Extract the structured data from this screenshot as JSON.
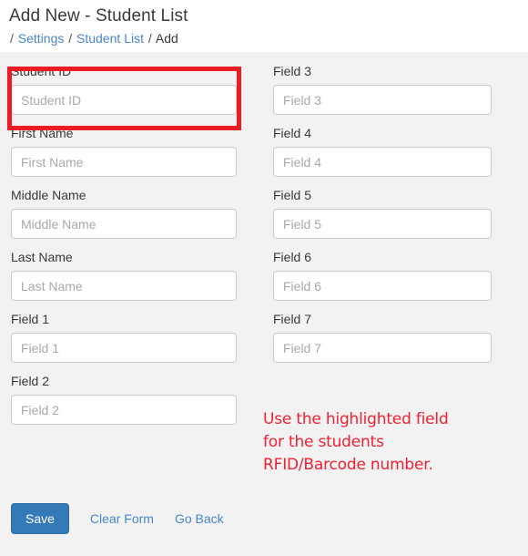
{
  "header": {
    "title": "Add New - Student List",
    "breadcrumb": {
      "separator": "/",
      "items": [
        {
          "label": "Settings",
          "is_link": true
        },
        {
          "label": "Student List",
          "is_link": true
        },
        {
          "label": "Add",
          "is_link": false
        }
      ]
    }
  },
  "form": {
    "left_column": [
      {
        "label": "Student ID",
        "placeholder": "Student ID",
        "value": "",
        "highlighted": true
      },
      {
        "label": "First Name",
        "placeholder": "First Name",
        "value": "",
        "highlighted": false
      },
      {
        "label": "Middle Name",
        "placeholder": "Middle Name",
        "value": "",
        "highlighted": false
      },
      {
        "label": "Last Name",
        "placeholder": "Last Name",
        "value": "",
        "highlighted": false
      },
      {
        "label": "Field 1",
        "placeholder": "Field 1",
        "value": "",
        "highlighted": false
      },
      {
        "label": "Field 2",
        "placeholder": "Field 2",
        "value": "",
        "highlighted": false
      }
    ],
    "right_column": [
      {
        "label": "Field 3",
        "placeholder": "Field 3",
        "value": ""
      },
      {
        "label": "Field 4",
        "placeholder": "Field 4",
        "value": ""
      },
      {
        "label": "Field 5",
        "placeholder": "Field 5",
        "value": ""
      },
      {
        "label": "Field 6",
        "placeholder": "Field 6",
        "value": ""
      },
      {
        "label": "Field 7",
        "placeholder": "Field 7",
        "value": ""
      }
    ]
  },
  "annotation": {
    "line1": "Use the highlighted field",
    "line2": "for the students",
    "line3": "RFID/Barcode number.",
    "color": "#ee2233"
  },
  "highlight": {
    "color": "#ed1c24"
  },
  "actions": {
    "save_label": "Save",
    "clear_form_label": "Clear Form",
    "go_back_label": "Go Back",
    "save_color": "#337ab7",
    "link_color": "#4a86c8"
  }
}
